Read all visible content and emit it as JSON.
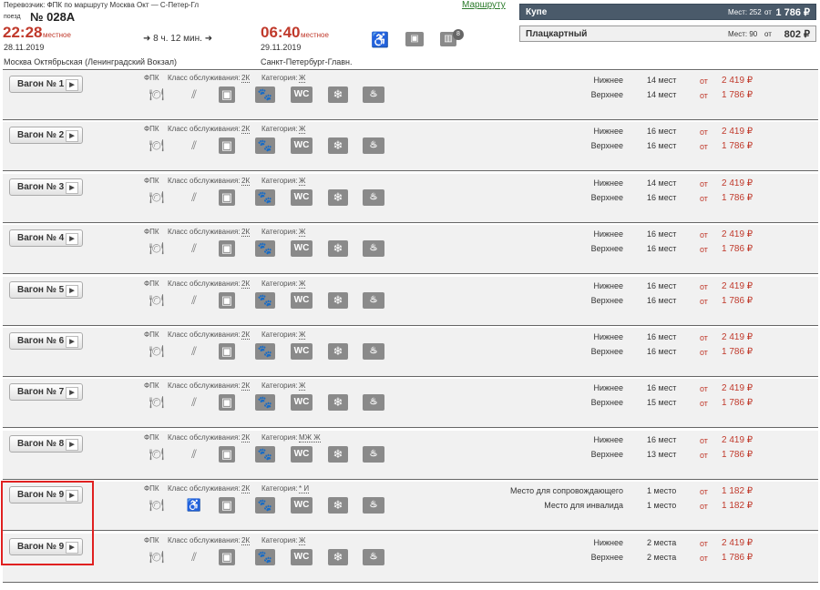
{
  "header": {
    "carrier_line": "Перевозчик: ФПК    по маршруту Москва Окт — С-Петер-Гл",
    "route_link": "Маршруту",
    "train_label": "поезд",
    "train_number": "№ 028А",
    "dep_time": "22:28",
    "dep_note": "местное",
    "dep_date": "28.11.2019",
    "dep_station": "Москва Октябрьская (Ленинградский Вокзал)",
    "duration": "8 ч. 12 мин.",
    "arr_time": "06:40",
    "arr_note": "местное",
    "arr_date": "29.11.2019",
    "arr_station": "Санкт-Петербург-Главн.",
    "badge_count": "8"
  },
  "classes": [
    {
      "name": "Купе",
      "seats": "Мест: 252",
      "from": "от",
      "price": "1 786 ₽"
    },
    {
      "name": "Плацкартный",
      "seats": "Мест: 90",
      "from": "от",
      "price": "802 ₽"
    }
  ],
  "cars": [
    {
      "label": "Вагон  № 1",
      "carrier": "ФПК",
      "service_label": "Класс обслуживания:",
      "service": "2К",
      "cat_label": "Категория:",
      "cat": "Ж",
      "row1": {
        "type": "Нижнее",
        "count": "14 мест",
        "from": "от",
        "price": "2 419 ₽"
      },
      "row2": {
        "type": "Верхнее",
        "count": "14 мест",
        "from": "от",
        "price": "1 786 ₽"
      }
    },
    {
      "label": "Вагон  № 2",
      "carrier": "ФПК",
      "service_label": "Класс обслуживания:",
      "service": "2К",
      "cat_label": "Категория:",
      "cat": "Ж",
      "row1": {
        "type": "Нижнее",
        "count": "16 мест",
        "from": "от",
        "price": "2 419 ₽"
      },
      "row2": {
        "type": "Верхнее",
        "count": "16 мест",
        "from": "от",
        "price": "1 786 ₽"
      }
    },
    {
      "label": "Вагон  № 3",
      "carrier": "ФПК",
      "service_label": "Класс обслуживания:",
      "service": "2К",
      "cat_label": "Категория:",
      "cat": "Ж",
      "row1": {
        "type": "Нижнее",
        "count": "14 мест",
        "from": "от",
        "price": "2 419 ₽"
      },
      "row2": {
        "type": "Верхнее",
        "count": "16 мест",
        "from": "от",
        "price": "1 786 ₽"
      }
    },
    {
      "label": "Вагон  № 4",
      "carrier": "ФПК",
      "service_label": "Класс обслуживания:",
      "service": "2К",
      "cat_label": "Категория:",
      "cat": "Ж",
      "row1": {
        "type": "Нижнее",
        "count": "16 мест",
        "from": "от",
        "price": "2 419 ₽"
      },
      "row2": {
        "type": "Верхнее",
        "count": "16 мест",
        "from": "от",
        "price": "1 786 ₽"
      }
    },
    {
      "label": "Вагон  № 5",
      "carrier": "ФПК",
      "service_label": "Класс обслуживания:",
      "service": "2К",
      "cat_label": "Категория:",
      "cat": "Ж",
      "row1": {
        "type": "Нижнее",
        "count": "16 мест",
        "from": "от",
        "price": "2 419 ₽"
      },
      "row2": {
        "type": "Верхнее",
        "count": "16 мест",
        "from": "от",
        "price": "1 786 ₽"
      }
    },
    {
      "label": "Вагон  № 6",
      "carrier": "ФПК",
      "service_label": "Класс обслуживания:",
      "service": "2К",
      "cat_label": "Категория:",
      "cat": "Ж",
      "row1": {
        "type": "Нижнее",
        "count": "16 мест",
        "from": "от",
        "price": "2 419 ₽"
      },
      "row2": {
        "type": "Верхнее",
        "count": "16 мест",
        "from": "от",
        "price": "1 786 ₽"
      }
    },
    {
      "label": "Вагон  № 7",
      "carrier": "ФПК",
      "service_label": "Класс обслуживания:",
      "service": "2К",
      "cat_label": "Категория:",
      "cat": "Ж",
      "row1": {
        "type": "Нижнее",
        "count": "16 мест",
        "from": "от",
        "price": "2 419 ₽"
      },
      "row2": {
        "type": "Верхнее",
        "count": "15 мест",
        "from": "от",
        "price": "1 786 ₽"
      }
    },
    {
      "label": "Вагон  № 8",
      "carrier": "ФПК",
      "service_label": "Класс обслуживания:",
      "service": "2К",
      "cat_label": "Категория:",
      "cat": "МЖ Ж",
      "row1": {
        "type": "Нижнее",
        "count": "16 мест",
        "from": "от",
        "price": "2 419 ₽"
      },
      "row2": {
        "type": "Верхнее",
        "count": "13 мест",
        "from": "от",
        "price": "1 786 ₽"
      }
    },
    {
      "label": "Вагон  № 9",
      "carrier": "ФПК",
      "service_label": "Класс обслуживания:",
      "service": "2К",
      "cat_label": "Категория:",
      "cat": "* И",
      "row1": {
        "type": "Место для сопровождающего",
        "count": "1 место",
        "from": "от",
        "price": "1 182 ₽"
      },
      "row2": {
        "type": "Место для инвалида",
        "count": "1 место",
        "from": "от",
        "price": "1 182 ₽"
      }
    },
    {
      "label": "Вагон  № 9",
      "carrier": "ФПК",
      "service_label": "Класс обслуживания:",
      "service": "2К",
      "cat_label": "Категория:",
      "cat": "Ж",
      "row1": {
        "type": "Нижнее",
        "count": "2 места",
        "from": "от",
        "price": "2 419 ₽"
      },
      "row2": {
        "type": "Верхнее",
        "count": "2 места",
        "from": "от",
        "price": "1 786 ₽"
      }
    }
  ]
}
